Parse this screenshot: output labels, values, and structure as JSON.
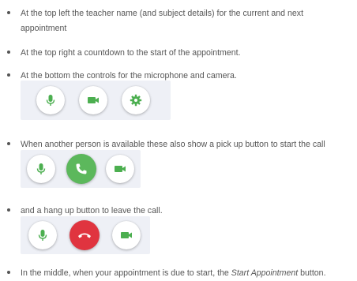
{
  "colors": {
    "icon_green": "#4caf50",
    "call_green": "#5cb85c",
    "hangup_red": "#e0343f",
    "panel_bg": "#eef0f6",
    "text": "#565656"
  },
  "items": [
    {
      "line1": "At the top left the teacher name (and subject details) for the current and next",
      "line2": "appointment"
    },
    {
      "text": "At the top right a countdown to the start of the appointment."
    },
    {
      "text": "At the bottom the controls for the microphone and camera.",
      "controls": [
        {
          "icon": "microphone-icon"
        },
        {
          "icon": "video-camera-icon"
        },
        {
          "icon": "gear-icon"
        }
      ]
    },
    {
      "text": "When another person is available these also show a pick up button to start the call",
      "controls": [
        {
          "icon": "microphone-icon"
        },
        {
          "icon": "phone-icon"
        },
        {
          "icon": "video-camera-icon"
        }
      ]
    },
    {
      "text": "and a hang up button to leave the call.",
      "controls": [
        {
          "icon": "microphone-icon"
        },
        {
          "icon": "hang-up-icon"
        },
        {
          "icon": "video-camera-icon"
        }
      ]
    },
    {
      "before": "In the middle, when your appointment is due to start, the ",
      "emphasis": "Start Appointment",
      "after": " button."
    }
  ]
}
